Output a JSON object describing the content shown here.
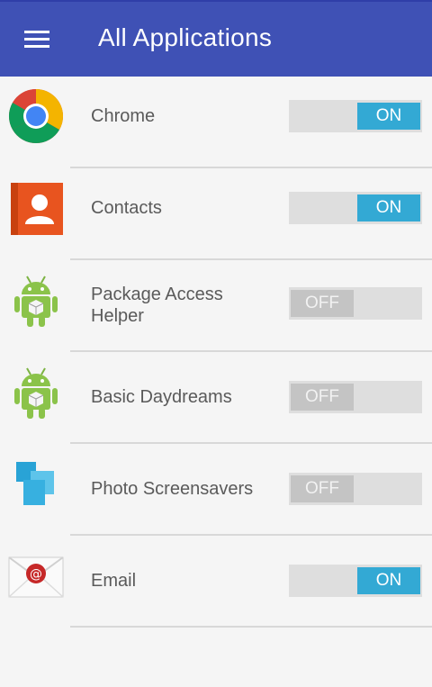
{
  "appbar": {
    "title": "All Applications",
    "menu_icon": "hamburger-menu-icon"
  },
  "apps": [
    {
      "name": "Chrome",
      "icon": "chrome-icon",
      "state": "ON"
    },
    {
      "name": "Contacts",
      "icon": "contacts-icon",
      "state": "ON"
    },
    {
      "name_line1": "Package Access",
      "name_line2": "Helper",
      "icon": "android-icon",
      "state": "OFF"
    },
    {
      "name": "Basic Daydreams",
      "icon": "android-icon",
      "state": "OFF"
    },
    {
      "name": "Photo Screensavers",
      "icon": "photo-screensavers-icon",
      "state": "OFF"
    },
    {
      "name": "Email",
      "icon": "email-icon",
      "state": "ON"
    }
  ],
  "colors": {
    "appbar": "#3f51b5",
    "toggle_on": "#33a9d4",
    "toggle_off": "#c4c4c4"
  }
}
